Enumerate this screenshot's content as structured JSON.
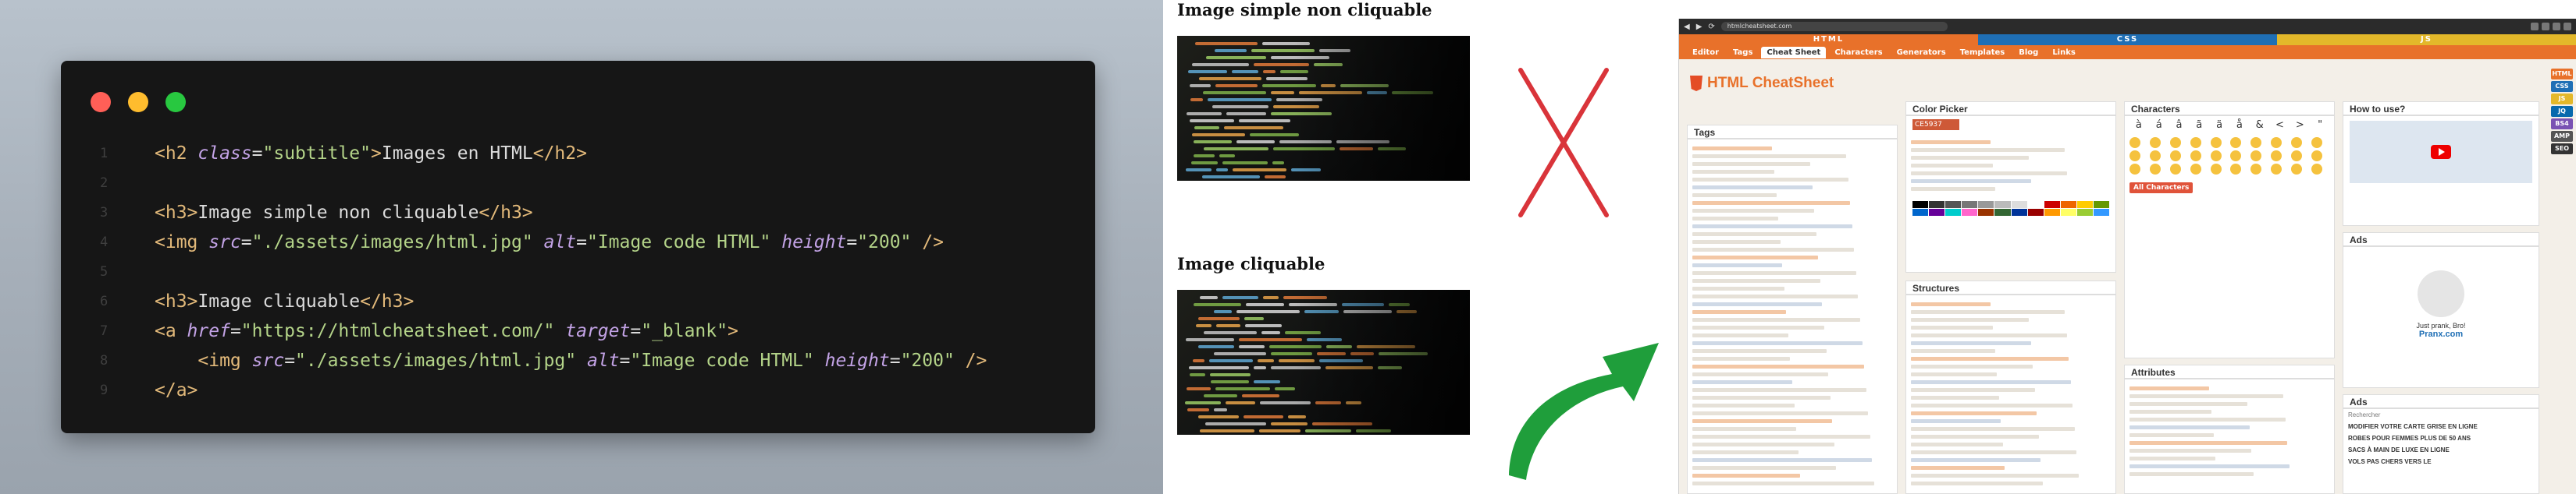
{
  "code_editor": {
    "lines": [
      {
        "num": "1",
        "tokens": [
          [
            "tag",
            "<h2 "
          ],
          [
            "attr",
            "class"
          ],
          [
            "eq",
            "="
          ],
          [
            "str",
            "\"subtitle\""
          ],
          [
            "tag",
            ">"
          ],
          [
            "txt",
            "Images en HTML"
          ],
          [
            "tag",
            "</h2>"
          ]
        ]
      },
      {
        "num": "2",
        "tokens": []
      },
      {
        "num": "3",
        "tokens": [
          [
            "tag",
            "<h3>"
          ],
          [
            "txt",
            "Image simple non cliquable"
          ],
          [
            "tag",
            "</h3>"
          ]
        ]
      },
      {
        "num": "4",
        "tokens": [
          [
            "tag",
            "<img "
          ],
          [
            "attr",
            "src"
          ],
          [
            "eq",
            "="
          ],
          [
            "str",
            "\"./assets/images/html.jpg\""
          ],
          [
            "txt",
            " "
          ],
          [
            "attr",
            "alt"
          ],
          [
            "eq",
            "="
          ],
          [
            "str",
            "\"Image code HTML\""
          ],
          [
            "txt",
            " "
          ],
          [
            "attr",
            "height"
          ],
          [
            "eq",
            "="
          ],
          [
            "str",
            "\"200\""
          ],
          [
            "tag",
            " />"
          ]
        ]
      },
      {
        "num": "5",
        "tokens": []
      },
      {
        "num": "6",
        "tokens": [
          [
            "tag",
            "<h3>"
          ],
          [
            "txt",
            "Image cliquable"
          ],
          [
            "tag",
            "</h3>"
          ]
        ]
      },
      {
        "num": "7",
        "tokens": [
          [
            "tag",
            "<a "
          ],
          [
            "attr",
            "href"
          ],
          [
            "eq",
            "="
          ],
          [
            "str",
            "\"https://htmlcheatsheet.com/\""
          ],
          [
            "txt",
            " "
          ],
          [
            "attr",
            "target"
          ],
          [
            "eq",
            "="
          ],
          [
            "str",
            "\"_blank\""
          ],
          [
            "tag",
            ">"
          ]
        ]
      },
      {
        "num": "8",
        "tokens": [
          [
            "txt",
            "    "
          ],
          [
            "tag",
            "<img "
          ],
          [
            "attr",
            "src"
          ],
          [
            "eq",
            "="
          ],
          [
            "str",
            "\"./assets/images/html.jpg\""
          ],
          [
            "txt",
            " "
          ],
          [
            "attr",
            "alt"
          ],
          [
            "eq",
            "="
          ],
          [
            "str",
            "\"Image code HTML\""
          ],
          [
            "txt",
            " "
          ],
          [
            "attr",
            "height"
          ],
          [
            "eq",
            "="
          ],
          [
            "str",
            "\"200\""
          ],
          [
            "tag",
            " />"
          ]
        ]
      },
      {
        "num": "9",
        "tokens": [
          [
            "tag",
            "</a>"
          ]
        ]
      }
    ]
  },
  "preview": {
    "title_non_clickable": "Image simple non cliquable",
    "title_clickable": "Image cliquable"
  },
  "browser": {
    "url": "htmlcheatsheet.com",
    "stripes": [
      "HTML",
      "CSS",
      "JS"
    ],
    "menu": [
      "Editor",
      "Tags",
      "Cheat Sheet",
      "Characters",
      "Generators",
      "Templates",
      "Blog",
      "Links"
    ],
    "logo": "HTML CheatSheet",
    "panels": {
      "tags": "Tags",
      "color_picker": "Color Picker",
      "characters": "Characters",
      "structures": "Structures",
      "attributes": "Attributes",
      "how_to_use": "How to use?",
      "ads": "Ads",
      "ads2": "Ads"
    },
    "color_value": "CE5937",
    "chars": [
      "à",
      "á",
      "â",
      "ã",
      "ä",
      "å",
      "&",
      "<",
      ">",
      "\""
    ],
    "ad_brand": "Pranx.com",
    "ad_caption": "Just prank, Bro!",
    "all_characters": "All Characters",
    "ads_search": "Rechercher",
    "ad_items": [
      "MODIFIER VOTRE CARTE GRISE EN LIGNE",
      "ROBES POUR FEMMES PLUS DE 50 ANS",
      "SACS À MAIN DE LUXE EN LIGNE",
      "VOLS PAS CHERS VERS LE"
    ],
    "side_nav": [
      "HTML",
      "CSS",
      "JS",
      "JQ",
      "BS4",
      "AMP",
      "SEO"
    ]
  },
  "colors": {
    "cross": "#d9343a",
    "arrow": "#1f9e3b",
    "accent": "#e8712a"
  }
}
